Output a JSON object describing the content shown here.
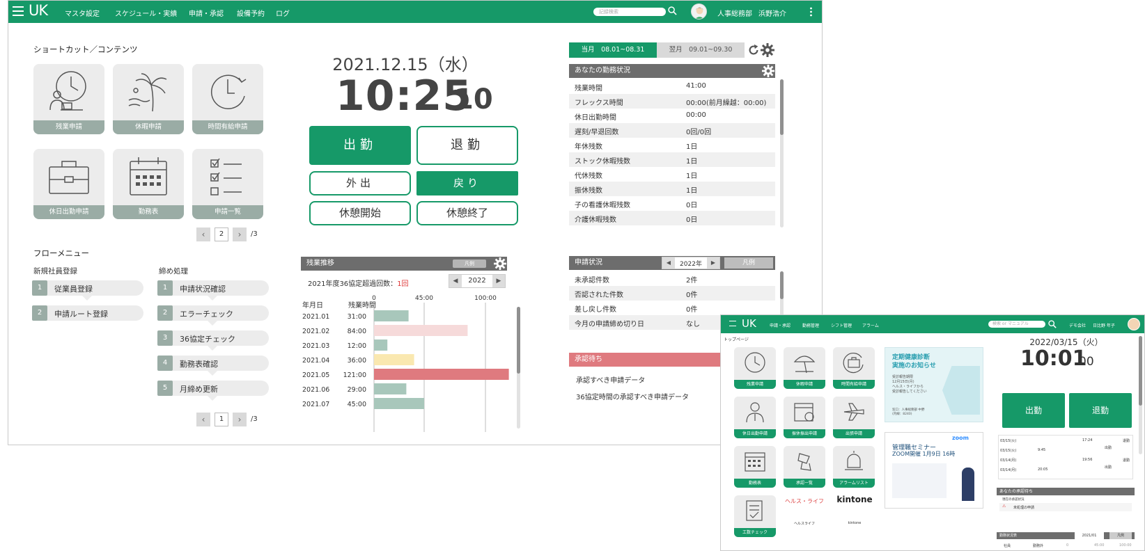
{
  "main": {
    "nav": {
      "logo": "UK",
      "menu": [
        "マスタ設定",
        "スケジュール・実績",
        "申請・承認",
        "設備予約",
        "ログ"
      ],
      "search_placeholder": "記録検索",
      "department": "人事総務部",
      "user_name": "浜野浩介"
    },
    "shortcuts": {
      "title": "ショートカット／コンテンツ",
      "tiles": [
        "残業申請",
        "休暇申請",
        "時間有給申請",
        "休日出勤申請",
        "勤務表",
        "申請一覧"
      ],
      "page": "2",
      "total": "/3"
    },
    "flow": {
      "title": "フローメニュー",
      "groups": [
        {
          "title": "新規社員登録",
          "items": [
            {
              "num": "1",
              "label": "従業員登録"
            },
            {
              "num": "2",
              "label": "申請ルート登録"
            }
          ]
        },
        {
          "title": "締め処理",
          "items": [
            {
              "num": "1",
              "label": "申請状況確認"
            },
            {
              "num": "2",
              "label": "エラーチェック"
            },
            {
              "num": "3",
              "label": "36協定チェック"
            },
            {
              "num": "4",
              "label": "勤務表確認"
            },
            {
              "num": "5",
              "label": "月締め更新"
            }
          ]
        }
      ],
      "page": "1",
      "total": "/3"
    },
    "clock": {
      "date": "2021.12.15（水）",
      "time": "10:25",
      "seconds": "10",
      "buttons": {
        "clock_in": "出勤",
        "clock_out": "退勤",
        "go_out": "外出",
        "return": "戻り",
        "break_start": "休憩開始",
        "break_end": "休憩終了"
      }
    },
    "overtime": {
      "title": "残業推移",
      "legend_btn": "凡例",
      "exceed_label": "2021年度36協定超過回数：",
      "exceed_count": "1回",
      "year": "2022",
      "col_month": "年月日",
      "col_hours": "残業時間"
    },
    "period_tabs": {
      "current": "当月　08.01~08.31",
      "next": "翌月　09.01~09.30"
    },
    "work_status": {
      "title": "あなたの勤務状況",
      "rows": [
        {
          "label": "残業時間",
          "value": "41:00"
        },
        {
          "label": "フレックス時間",
          "value": "00:00(前月繰越：00:00)"
        },
        {
          "label": "休日出勤時間",
          "value": "00:00"
        },
        {
          "label": "遅刻/早退回数",
          "value": "0回/0回"
        },
        {
          "label": "年休残数",
          "value": "1日"
        },
        {
          "label": "ストック休暇残数",
          "value": "1日"
        },
        {
          "label": "代休残数",
          "value": "1日"
        },
        {
          "label": "振休残数",
          "value": "1日"
        },
        {
          "label": "子の看護休暇残数",
          "value": "0日"
        },
        {
          "label": "介護休暇残数",
          "value": "0日"
        }
      ]
    },
    "application_status": {
      "title": "申請状況",
      "year": "2022年",
      "legend_btn": "凡例",
      "rows": [
        {
          "label": "未承認件数",
          "value": "2件"
        },
        {
          "label": "否認された件数",
          "value": "0件"
        },
        {
          "label": "差し戻し件数",
          "value": "0件"
        },
        {
          "label": "今月の申請締め切り日",
          "value": "なし"
        }
      ]
    },
    "approval": {
      "title": "承認待ち",
      "items": [
        "承認すべき申請データ",
        "36協定時間の承認すべき申請データ"
      ]
    }
  },
  "chart_data": {
    "type": "bar",
    "orientation": "horizontal",
    "categories": [
      "2021.01",
      "2021.02",
      "2021.03",
      "2021.04",
      "2021.05",
      "2021.06",
      "2021.07"
    ],
    "values": [
      31,
      84,
      12,
      36,
      121,
      29,
      45
    ],
    "labels": [
      "31:00",
      "84:00",
      "12:00",
      "36:00",
      "121:00",
      "29:00",
      "45:00"
    ],
    "ticks": [
      "0",
      "45:00",
      "100:00"
    ],
    "tick_values": [
      0,
      45,
      100
    ],
    "xlim": [
      0,
      100
    ],
    "colors": [
      "#a8c7bb",
      "#f6dada",
      "#a8c7bb",
      "#fae8b0",
      "#df7a7f",
      "#a8c7bb",
      "#a8c7bb"
    ],
    "grid": true
  },
  "second": {
    "nav": {
      "logo": "UK",
      "menu": [
        "申請・承認",
        "勤務管理",
        "シフト管理",
        "アラーム"
      ],
      "search_placeholder": "検索 or マニュアル",
      "company": "デモ会社",
      "user": "日比野 年子"
    },
    "breadcrumb": "トップページ",
    "tiles": [
      "残業申請",
      "休暇申請",
      "時間有給申請",
      "休日出勤申請",
      "振休振出申請",
      "出張申請",
      "勤務表",
      "承認一覧",
      "アラームリスト",
      "工数チェック"
    ],
    "links": [
      "ヘルスライフ",
      "kintone"
    ],
    "link_logos": [
      "ヘルス・ライフ",
      "kintone"
    ],
    "banner1": {
      "title_line1": "定期健康診断",
      "title_line2": "実施のお知らせ",
      "body": "受診報告期限\n12月15日(月)\nヘルス・ライフから\n受診報告してください",
      "note": "窓口：人事総務部 中野\n(内線：8240)"
    },
    "banner2": {
      "brand": "zoom",
      "line1": "管理職セミナー",
      "line2": "ZOOM開催 1月9日 16時"
    },
    "clock": {
      "date": "2022/03/15（火）",
      "time": "10:01",
      "seconds": "00",
      "clock_in": "出勤",
      "clock_out": "退勤"
    },
    "log": [
      {
        "date": "03/15(火)",
        "time": "",
        "time2": "17:24",
        "tag": "退勤"
      },
      {
        "date": "03/15(火)",
        "time": "9:45",
        "time2": "",
        "tag": "出勤"
      },
      {
        "date": "03/14(月)",
        "time": "",
        "time2": "19:56",
        "tag": "退勤"
      },
      {
        "date": "03/14(月)",
        "time": "20:05",
        "time2": "",
        "tag": "出勤"
      }
    ],
    "approval_title": "あなたの承認待ち",
    "approval_sub": "現在の承認状況",
    "approval_item": "未処理の申請",
    "work_title": "勤務状況表",
    "work_year": "2021/01",
    "work_legend": "凡例",
    "work_cols": [
      "社員",
      "勤務外",
      "0",
      "45:00",
      "100:00"
    ]
  }
}
